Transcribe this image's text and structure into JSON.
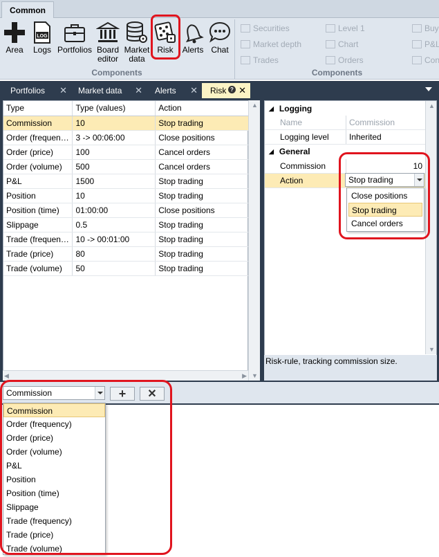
{
  "ribbon": {
    "tab": "Common",
    "buttons": [
      {
        "label": "Area",
        "icon": "plus-icon"
      },
      {
        "label": "Logs",
        "icon": "log-icon"
      },
      {
        "label": "Portfolios",
        "icon": "briefcase-icon"
      },
      {
        "label": "Board editor",
        "line1": "Board",
        "line2": "editor",
        "icon": "bank-icon"
      },
      {
        "label": "Market data",
        "line1": "Market",
        "line2": "data",
        "icon": "database-gear-icon"
      },
      {
        "label": "Risk",
        "icon": "dice-icon"
      },
      {
        "label": "Alerts",
        "icon": "bell-icon"
      },
      {
        "label": "Chat",
        "icon": "chat-bubble-icon"
      }
    ],
    "group1_label": "Components",
    "group2_label": "Components",
    "disabled_items": {
      "securities": "Securities",
      "market_depth": "Market depth",
      "trades": "Trades",
      "level1": "Level 1",
      "chart": "Chart",
      "orders": "Orders",
      "buy": "Buy",
      "pl": "P&L",
      "con": "Con"
    }
  },
  "doc_tabs": [
    {
      "label": "Portfolios"
    },
    {
      "label": "Market data"
    },
    {
      "label": "Alerts"
    },
    {
      "label": "Risk",
      "active": true
    }
  ],
  "grid": {
    "headers": [
      "Type",
      "Type (values)",
      "Action"
    ],
    "rows": [
      [
        "Commission",
        "10",
        "Stop trading"
      ],
      [
        "Order (frequen…",
        "3 -> 00:06:00",
        "Close positions"
      ],
      [
        "Order (price)",
        "100",
        "Cancel orders"
      ],
      [
        "Order (volume)",
        "500",
        "Cancel orders"
      ],
      [
        "P&L",
        "1500",
        "Stop trading"
      ],
      [
        "Position",
        "10",
        "Stop trading"
      ],
      [
        "Position (time)",
        "01:00:00",
        "Close positions"
      ],
      [
        "Slippage",
        "0.5",
        "Stop trading"
      ],
      [
        "Trade (frequen…",
        "10 -> 00:01:00",
        "Stop trading"
      ],
      [
        "Trade (price)",
        "80",
        "Stop trading"
      ],
      [
        "Trade (volume)",
        "50",
        "Stop trading"
      ]
    ]
  },
  "properties": {
    "cat_logging": "Logging",
    "name_label": "Name",
    "name_value": "Commission",
    "logging_level_label": "Logging level",
    "logging_level_value": "Inherited",
    "cat_general": "General",
    "commission_label": "Commission",
    "commission_value": "10",
    "action_label": "Action",
    "action_value": "Stop trading",
    "action_options": [
      "Close positions",
      "Stop trading",
      "Cancel orders"
    ],
    "description": "Risk-rule, tracking commission size."
  },
  "bottom": {
    "type_value": "Commission",
    "add_symbol": "+",
    "remove_symbol": "✕",
    "type_options": [
      "Commission",
      "Order (frequency)",
      "Order (price)",
      "Order (volume)",
      "P&L",
      "Position",
      "Position (time)",
      "Slippage",
      "Trade (frequency)",
      "Trade (price)",
      "Trade (volume)"
    ]
  }
}
